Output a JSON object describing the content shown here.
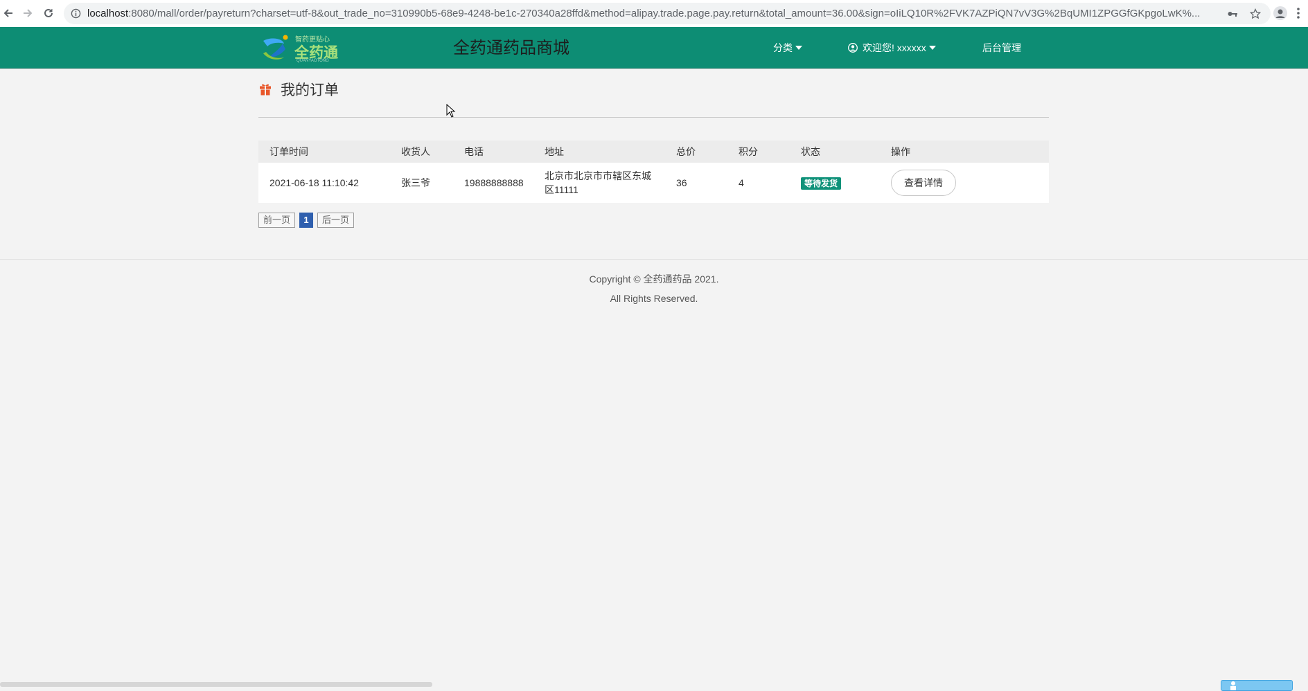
{
  "browser": {
    "url_host": "localhost",
    "url_rest": ":8080/mall/order/payreturn?charset=utf-8&out_trade_no=310990b5-68e9-4248-be1c-270340a28ffd&method=alipay.trade.page.pay.return&total_amount=36.00&sign=oIiLQ10R%2FVK7AZPiQN7vV3G%2BqUMI1ZPGGfGKpgoLwK%..."
  },
  "header": {
    "logo_small_text": "智药更贴心",
    "logo_big_text": "全药通",
    "logo_tiny_text": "QUANYAOTONG",
    "site_title": "全药通药品商城",
    "nav_category": "分类",
    "nav_user": "欢迎您! xxxxxx",
    "nav_admin": "后台管理"
  },
  "page": {
    "title": "我的订单"
  },
  "table": {
    "headers": [
      "订单时间",
      "收货人",
      "电话",
      "地址",
      "总价",
      "积分",
      "状态",
      "操作"
    ],
    "rows": [
      {
        "time": "2021-06-18 11:10:42",
        "receiver": "张三爷",
        "phone": "19888888888",
        "address_line1": "北京市北京市市辖区东城",
        "address_line2": "区11111",
        "total": "36",
        "points": "4",
        "status": "等待发货",
        "action": "查看详情"
      }
    ]
  },
  "pager": {
    "prev": "前一页",
    "current": "1",
    "next": "后一页"
  },
  "footer": {
    "line1": "Copyright © 全药通药品 2021.",
    "line2": "All Rights Reserved."
  },
  "colors": {
    "header_bg": "#0d8d74",
    "status_badge": "#10927a",
    "pager_current": "#2f5fae",
    "gift_icon": "#e8572a"
  }
}
